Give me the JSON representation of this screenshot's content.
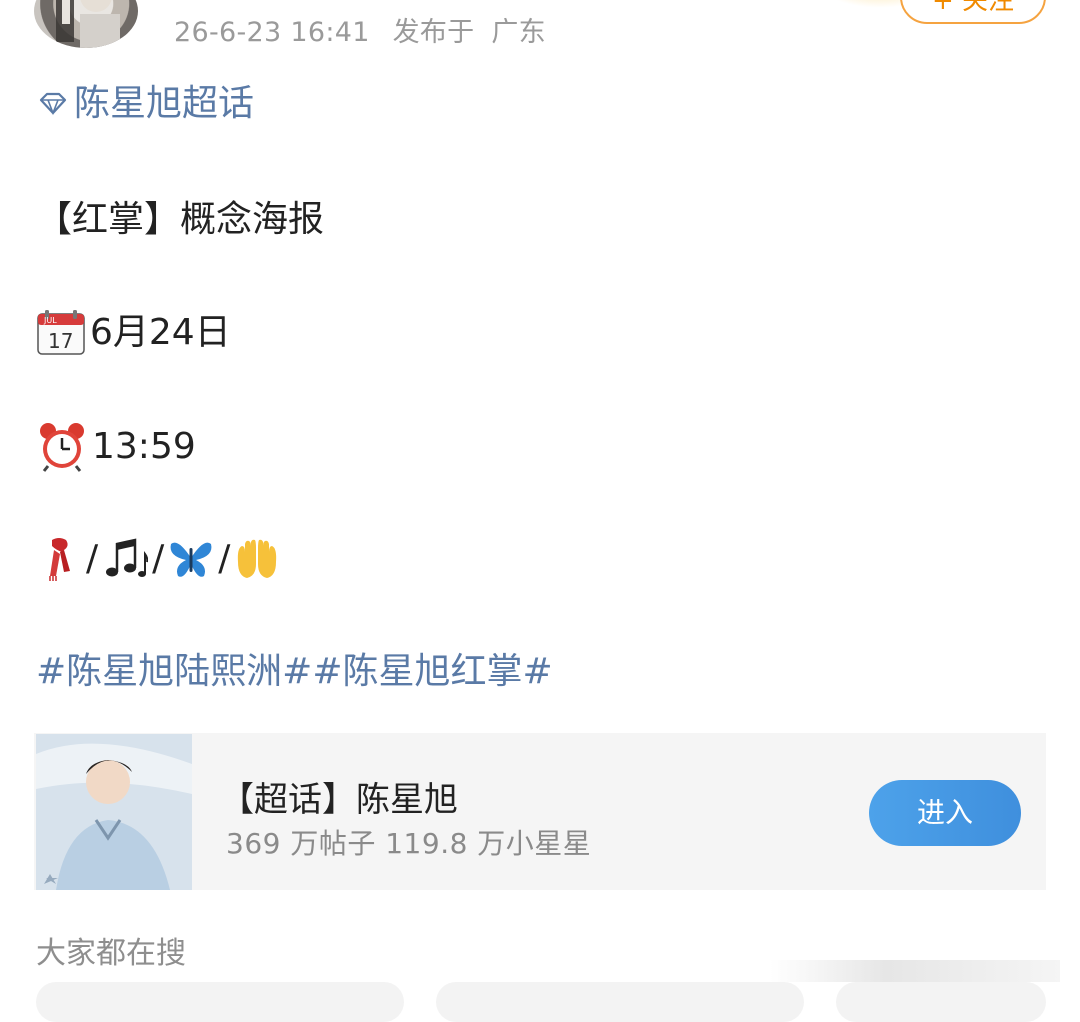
{
  "header": {
    "timestamp": "26-6-23 16:41",
    "location_label": "发布于",
    "location": "广东",
    "follow_label": "+ 关注"
  },
  "post": {
    "super_topic": "陈星旭超话",
    "title": "【红掌】概念海报",
    "date": "6月24日",
    "time": "13:59",
    "separator": "/",
    "emoji_icons": [
      "scarf-icon",
      "music-notes-icon",
      "butterfly-icon",
      "raised-hands-icon"
    ],
    "hashtags": [
      "#陈星旭陆熙洲#",
      "#陈星旭红掌#"
    ]
  },
  "super_topic_card": {
    "title": "【超话】陈星旭",
    "stats": "369 万帖子 119.8 万小星星",
    "enter_label": "进入"
  },
  "trending": {
    "label": "大家都在搜"
  },
  "colors": {
    "link": "#5a7aa6",
    "follow": "#f08a00",
    "enter_button": "#4a9be6"
  }
}
